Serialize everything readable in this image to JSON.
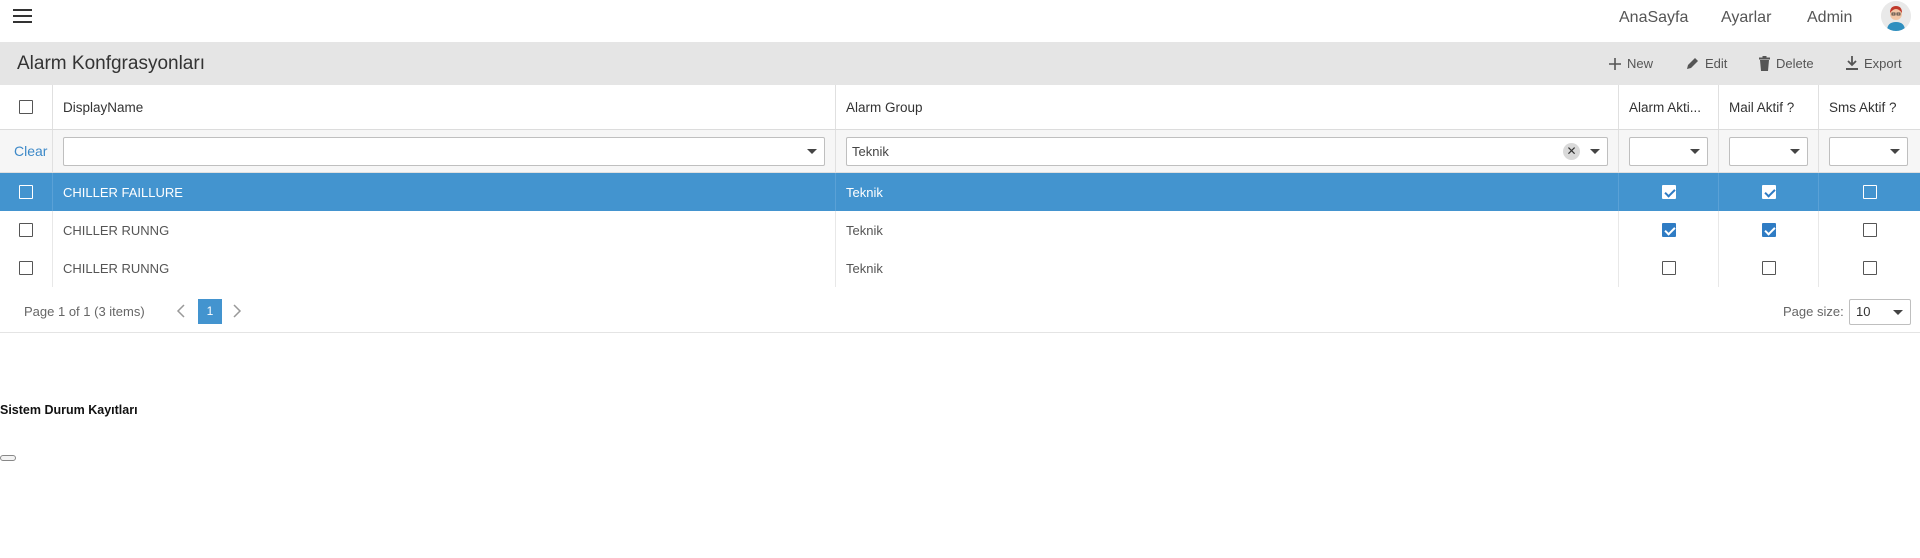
{
  "nav": {
    "home": "AnaSayfa",
    "settings": "Ayarlar",
    "admin": "Admin"
  },
  "grid": {
    "title": "Alarm Konfgrasyonları",
    "toolbar": {
      "new": "New",
      "edit": "Edit",
      "delete": "Delete",
      "export": "Export"
    },
    "columns": {
      "display_name": "DisplayName",
      "alarm_group": "Alarm Group",
      "alarm_active": "Alarm Akti...",
      "mail_active": "Mail Aktif ?",
      "sms_active": "Sms Aktif ?"
    },
    "filter": {
      "clear": "Clear",
      "display_name": "",
      "alarm_group": "Teknik",
      "clear_symbol": "✕"
    },
    "rows": [
      {
        "display_name": "CHILLER FAILLURE",
        "alarm_group": "Teknik",
        "alarm_active": true,
        "mail_active": true,
        "sms_active": false,
        "selected": true
      },
      {
        "display_name": "CHILLER RUNNG",
        "alarm_group": "Teknik",
        "alarm_active": true,
        "mail_active": true,
        "sms_active": false,
        "selected": false
      },
      {
        "display_name": "CHILLER RUNNG",
        "alarm_group": "Teknik",
        "alarm_active": false,
        "mail_active": false,
        "sms_active": false,
        "selected": false
      }
    ],
    "pager": {
      "summary": "Page 1 of 1 (3 items)",
      "current_page": "1",
      "page_size_label": "Page size:",
      "page_size": "10"
    }
  },
  "section": {
    "title": "Sistem Durum Kayıtları"
  },
  "colors": {
    "accent": "#4394cf",
    "header_bg": "#e5e5e5",
    "link": "#3d89c8"
  },
  "icons": {
    "menu": "hamburger-menu-icon",
    "new": "plus-icon",
    "edit": "pencil-icon",
    "delete": "trash-icon",
    "export": "download-icon",
    "avatar": "user-avatar-icon"
  }
}
